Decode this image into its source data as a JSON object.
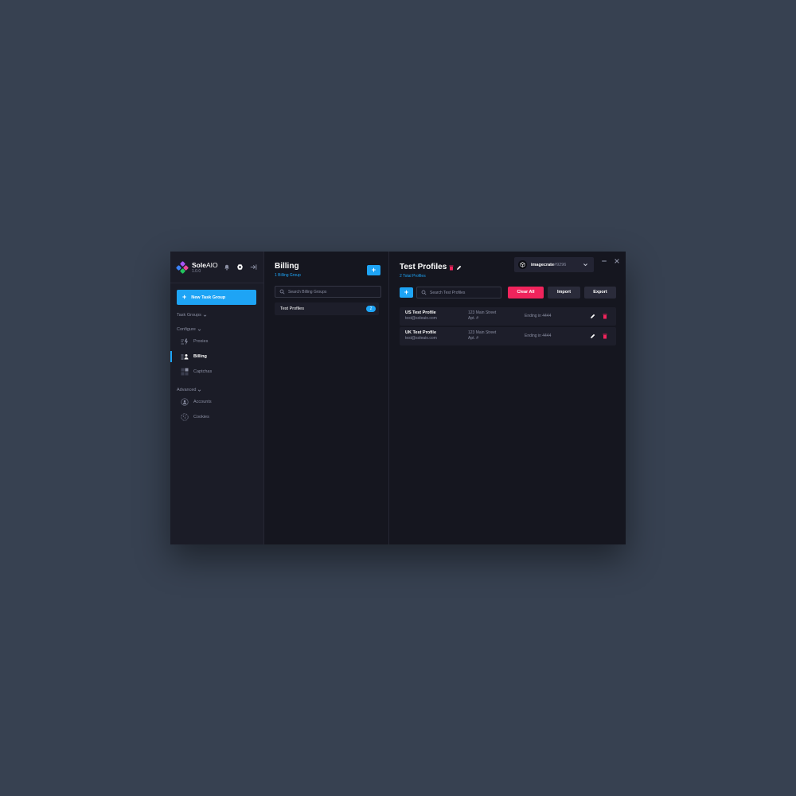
{
  "app": {
    "name_bold": "Sole",
    "name_light": "AIO",
    "version": "1.0.0"
  },
  "sidebar": {
    "new_task_group": "New Task Group",
    "sections": {
      "task_groups": "Task Groups",
      "configure": "Configure",
      "advanced": "Advanced"
    },
    "items": [
      {
        "label": "Proxies",
        "icon": "proxies-icon"
      },
      {
        "label": "Billing",
        "icon": "billing-icon",
        "active": true
      },
      {
        "label": "Captchas",
        "icon": "captchas-icon"
      },
      {
        "label": "Accounts",
        "icon": "accounts-icon"
      },
      {
        "label": "Cookies",
        "icon": "cookies-icon"
      }
    ]
  },
  "billing": {
    "title": "Billing",
    "subtitle": "1 Billing Group",
    "add_label": "+",
    "search_placeholder": "Search Billing Groups",
    "groups": [
      {
        "name": "Test Profiles",
        "count": "2"
      }
    ]
  },
  "profiles": {
    "title": "Test Profiles",
    "subtitle": "2 Total Profiles",
    "add_label": "+",
    "search_placeholder": "Search Test Profiles",
    "clear_all": "Clear All",
    "import": "Import",
    "export": "Export",
    "rows": [
      {
        "name": "US Test Profile",
        "email": "test@soleaio.com",
        "address1": "123 Main Street",
        "address2": "Apt. #",
        "card": "Ending in 4444"
      },
      {
        "name": "UK Test Profile",
        "email": "test@soleaio.com",
        "address1": "123 Main Street",
        "address2": "Apt. #",
        "card": "Ending in 4444"
      }
    ]
  },
  "user": {
    "name": "imagecrate",
    "tag": "#9296"
  },
  "colors": {
    "accent": "#1ea4f5",
    "danger": "#f0245c",
    "background": "#15161f",
    "sidebar": "#1b1c27"
  }
}
